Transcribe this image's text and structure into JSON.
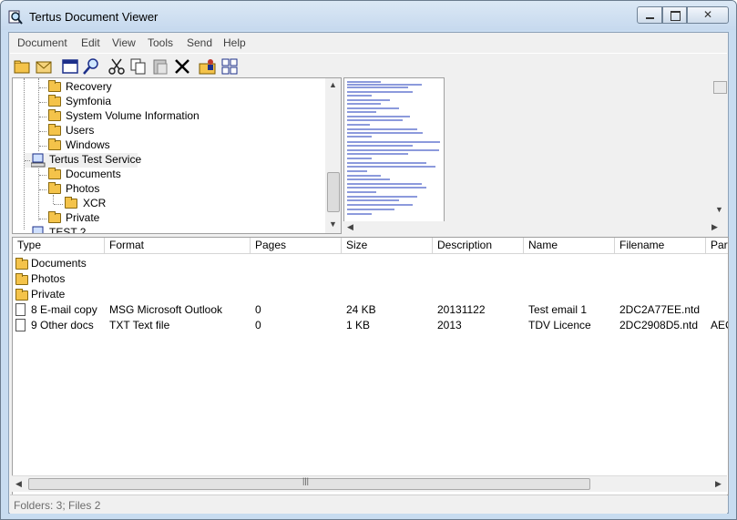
{
  "window": {
    "title": "Tertus Document Viewer",
    "caption_min": "—",
    "caption_max": "▢",
    "caption_close": "✕"
  },
  "menu": [
    "Document",
    "Edit",
    "View",
    "Tools",
    "Send",
    "Help"
  ],
  "toolbar": {
    "icons": [
      "open-folder-icon",
      "open-mail-icon",
      "window-icon",
      "search-icon",
      "cut-icon",
      "copy-icon",
      "paste-icon",
      "delete-icon",
      "folder-person-icon",
      "grid-view-icon"
    ]
  },
  "tree": {
    "items": [
      {
        "label": "Recovery",
        "level": 2,
        "icon": "folder-icon"
      },
      {
        "label": "Symfonia",
        "level": 2,
        "icon": "folder-icon"
      },
      {
        "label": "System Volume Information",
        "level": 2,
        "icon": "folder-icon"
      },
      {
        "label": "Users",
        "level": 2,
        "icon": "folder-icon"
      },
      {
        "label": "Windows",
        "level": 2,
        "icon": "folder-icon"
      },
      {
        "label": "Tertus Test Service",
        "level": 1,
        "icon": "computer-icon"
      },
      {
        "label": "Documents",
        "level": 2,
        "icon": "folder-icon"
      },
      {
        "label": "Photos",
        "level": 2,
        "icon": "folder-icon"
      },
      {
        "label": "XCR",
        "level": 3,
        "icon": "folder-icon"
      },
      {
        "label": "Private",
        "level": 2,
        "icon": "folder-icon"
      },
      {
        "label": "TEST 2",
        "level": 1,
        "icon": "computer-icon"
      }
    ]
  },
  "list": {
    "columns": [
      "Type",
      "Format",
      "Pages",
      "Size",
      "Description",
      "Name",
      "Filename",
      "Party"
    ],
    "folders": [
      "Documents",
      "Photos",
      "Private"
    ],
    "files": [
      {
        "type": "8 E-mail copy",
        "format": "MSG Microsoft Outlook",
        "pages": "0",
        "size": "24 KB",
        "description": "20131122",
        "name": "Test email 1",
        "filename": "2DC2A77EE.ntd",
        "party": ""
      },
      {
        "type": "9 Other docs",
        "format": "TXT Text file",
        "pages": "0",
        "size": "1 KB",
        "description": "2013",
        "name": "TDV Licence",
        "filename": "2DC2908D5.ntd",
        "party": "AEC"
      }
    ]
  },
  "status": {
    "text": "Folders: 3; Files 2"
  },
  "colors": {
    "folder": "#f4c34a",
    "titlebar": "#c8dcf0",
    "link": "#1a35b8"
  }
}
